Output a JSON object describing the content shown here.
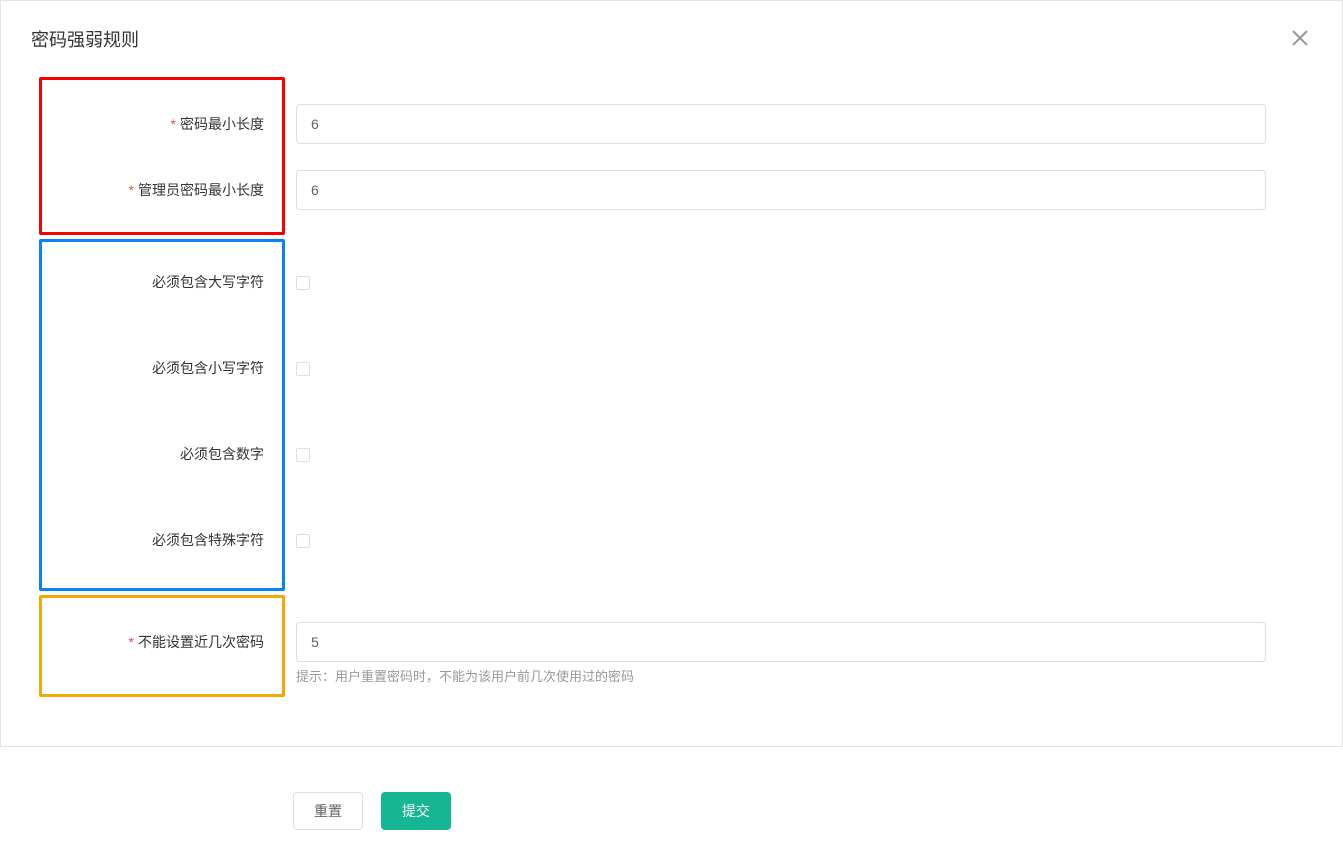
{
  "title": "密码强弱规则",
  "required_marker": "*",
  "fields": {
    "min_length": {
      "label": "密码最小长度",
      "value": "6"
    },
    "admin_min_length": {
      "label": "管理员密码最小长度",
      "value": "6"
    },
    "require_upper": {
      "label": "必须包含大写字符"
    },
    "require_lower": {
      "label": "必须包含小写字符"
    },
    "require_digit": {
      "label": "必须包含数字"
    },
    "require_special": {
      "label": "必须包含特殊字符"
    },
    "history_count": {
      "label": "不能设置近几次密码",
      "value": "5",
      "hint": "提示：用户重置密码时，不能为该用户前几次使用过的密码"
    }
  },
  "actions": {
    "reset": "重置",
    "submit": "提交"
  }
}
